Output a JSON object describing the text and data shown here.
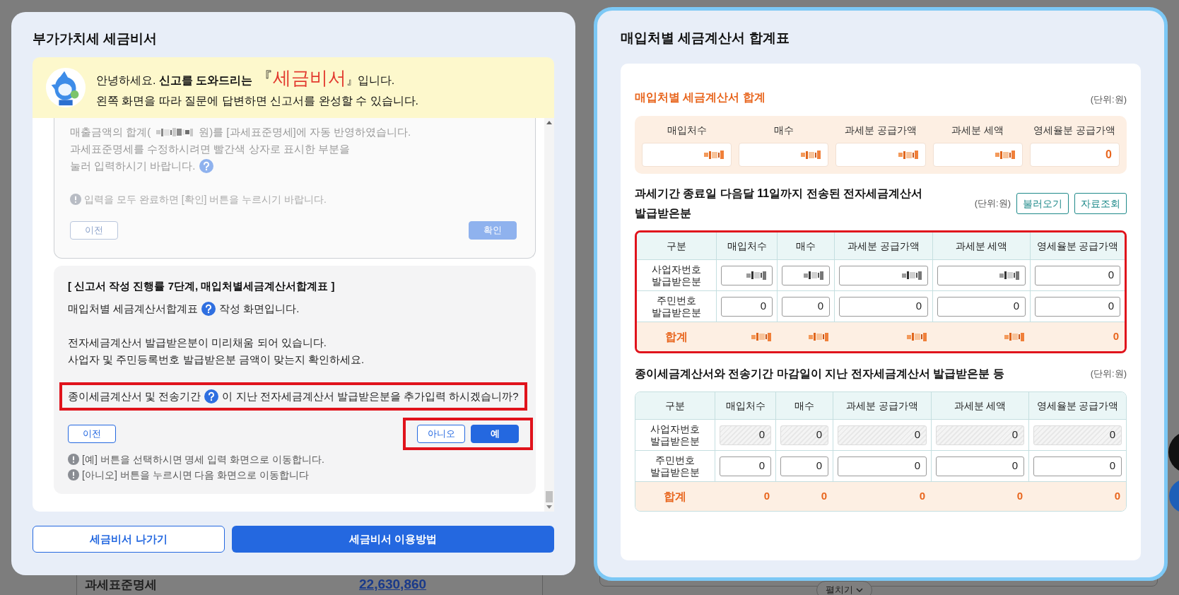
{
  "background": {
    "section_label": "과세표준명세",
    "amount": "22,630,860",
    "expand_button": "펼치기"
  },
  "assistant": {
    "focused": false,
    "title": "부가가치세 세금비서",
    "banner": {
      "greeting": "안녕하세요. **신고를 도와드리는**",
      "open_bracket": "『",
      "name": "세금비서",
      "close": "』입니다.",
      "subtitle": "왼쪽 화면을 따라 질문에 답변하면 신고서를 완성할 수 있습니다."
    },
    "steps": [
      {
        "active": false,
        "blocks": [
          {
            "kind": "paragraph",
            "highlighted": false,
            "lines": [
              [
                {
                  "kind": "text",
                  "text": "매출금액의 합계("
                },
                {
                  "kind": "redacted"
                },
                {
                  "kind": "text",
                  "text": "원)를 [과세표준명세]에 자동 반영하였습니다."
                }
              ],
              [
                {
                  "kind": "text",
                  "text": "과세표준명세를 수정하시려면 빨간색 상자로 표시한 부분을"
                }
              ],
              [
                {
                  "kind": "text",
                  "text": "눌러 입력하시기 바랍니다."
                },
                {
                  "kind": "help"
                }
              ]
            ]
          },
          {
            "kind": "note",
            "text": "입력을 모두 완료하면 [확인] 버튼을 누르시기 바랍니다."
          },
          {
            "kind": "buttons",
            "highlighted": false,
            "left": [
              {
                "label": "이전",
                "kind": "outline"
              }
            ],
            "right": [
              {
                "label": "확인",
                "kind": "primary"
              }
            ]
          }
        ]
      },
      {
        "active": true,
        "blocks": [
          {
            "kind": "heading",
            "text": "[ 신고서 작성 진행률 7단계, 매입처별세금계산서합계표 ]"
          },
          {
            "kind": "paragraph",
            "highlighted": false,
            "lines": [
              [
                {
                  "kind": "text",
                  "text": "매입처별 세금계산서합계표"
                },
                {
                  "kind": "help"
                },
                {
                  "kind": "text",
                  "text": "작성 화면입니다."
                }
              ]
            ]
          },
          {
            "kind": "paragraph",
            "highlighted": false,
            "lines": [
              [
                {
                  "kind": "text",
                  "text": "전자세금계산서 발급받은분이 미리채움 되어 있습니다."
                }
              ],
              [
                {
                  "kind": "text",
                  "text": "사업자 및 주민등록번호 발급받은분 금액이 맞는지 확인하세요."
                }
              ]
            ]
          },
          {
            "kind": "paragraph",
            "highlighted": true,
            "lines": [
              [
                {
                  "kind": "text",
                  "text": "종이세금계산서 및 전송기간"
                },
                {
                  "kind": "help"
                },
                {
                  "kind": "text",
                  "text": "이 지난 전자세금계산서 발급받은분을 추가입력 하시겠습니까?"
                }
              ]
            ]
          },
          {
            "kind": "buttons",
            "highlighted": true,
            "left": [
              {
                "label": "이전",
                "kind": "outline"
              }
            ],
            "right": [
              {
                "label": "아니오",
                "kind": "outline"
              },
              {
                "label": "예",
                "kind": "primary"
              }
            ]
          },
          {
            "kind": "note",
            "text": "[예] 버튼을 선택하시면 명세 입력 화면으로 이동합니다."
          },
          {
            "kind": "note",
            "text": "[아니오] 버튼을 누르시면 다음 화면으로 이동합니다"
          }
        ]
      }
    ],
    "footer_buttons": [
      {
        "label": "세금비서 나가기",
        "kind": "outline"
      },
      {
        "label": "세금비서 이용방법",
        "kind": "primary"
      }
    ]
  },
  "summary_form": {
    "focused": true,
    "title": "매입처별 세금계산서 합계표",
    "sections": [
      {
        "kind": "summary",
        "heading": "매입처별 세금계산서 합계",
        "unit": "(단위:원)",
        "columns": [
          "매입처수",
          "매수",
          "과세분 공급가액",
          "과세분 세액",
          "영세율분 공급가액"
        ],
        "values": [
          {
            "kind": "redacted"
          },
          {
            "kind": "redacted"
          },
          {
            "kind": "redacted"
          },
          {
            "kind": "redacted"
          },
          {
            "kind": "value",
            "text": "0"
          }
        ]
      },
      {
        "kind": "table",
        "heading": "과세기간 종료일 다음달 11일까지 전송된 전자세금계산서 발급받은분",
        "unit": "(단위:원)",
        "buttons": [
          "불러오기",
          "자료조회"
        ],
        "highlighted": true,
        "label_column": "구분",
        "columns": [
          "매입처수",
          "매수",
          "과세분 공급가액",
          "과세분 세액",
          "영세율분 공급가액"
        ],
        "rows": [
          {
            "label": "사업자번호 발급받은분",
            "disabled": false,
            "cells": [
              {
                "kind": "redacted"
              },
              {
                "kind": "redacted"
              },
              {
                "kind": "redacted"
              },
              {
                "kind": "redacted"
              },
              {
                "kind": "value",
                "text": "0"
              }
            ]
          },
          {
            "label": "주민번호 발급받은분",
            "disabled": false,
            "cells": [
              {
                "kind": "value",
                "text": "0"
              },
              {
                "kind": "value",
                "text": "0"
              },
              {
                "kind": "value",
                "text": "0"
              },
              {
                "kind": "value",
                "text": "0"
              },
              {
                "kind": "value",
                "text": "0"
              }
            ]
          }
        ],
        "total": {
          "label": "합계",
          "cells": [
            {
              "kind": "redacted"
            },
            {
              "kind": "redacted"
            },
            {
              "kind": "redacted"
            },
            {
              "kind": "redacted"
            },
            {
              "kind": "value",
              "text": "0"
            }
          ]
        }
      },
      {
        "kind": "table",
        "heading": "종이세금계산서와 전송기간 마감일이 지난 전자세금계산서 발급받은분 등",
        "unit": "(단위:원)",
        "highlighted": false,
        "label_column": "구분",
        "columns": [
          "매입처수",
          "매수",
          "과세분 공급가액",
          "과세분 세액",
          "영세율분 공급가액"
        ],
        "rows": [
          {
            "label": "사업자번호 발급받은분",
            "disabled": true,
            "cells": [
              {
                "kind": "value",
                "text": "0"
              },
              {
                "kind": "value",
                "text": "0"
              },
              {
                "kind": "value",
                "text": "0"
              },
              {
                "kind": "value",
                "text": "0"
              },
              {
                "kind": "value",
                "text": "0"
              }
            ]
          },
          {
            "label": "주민번호 발급받은분",
            "disabled": false,
            "cells": [
              {
                "kind": "value",
                "text": "0"
              },
              {
                "kind": "value",
                "text": "0"
              },
              {
                "kind": "value",
                "text": "0"
              },
              {
                "kind": "value",
                "text": "0"
              },
              {
                "kind": "value",
                "text": "0"
              }
            ]
          }
        ],
        "total": {
          "label": "합계",
          "cells": [
            {
              "kind": "value",
              "text": "0"
            },
            {
              "kind": "value",
              "text": "0"
            },
            {
              "kind": "value",
              "text": "0"
            },
            {
              "kind": "value",
              "text": "0"
            },
            {
              "kind": "value",
              "text": "0"
            }
          ]
        }
      }
    ]
  }
}
